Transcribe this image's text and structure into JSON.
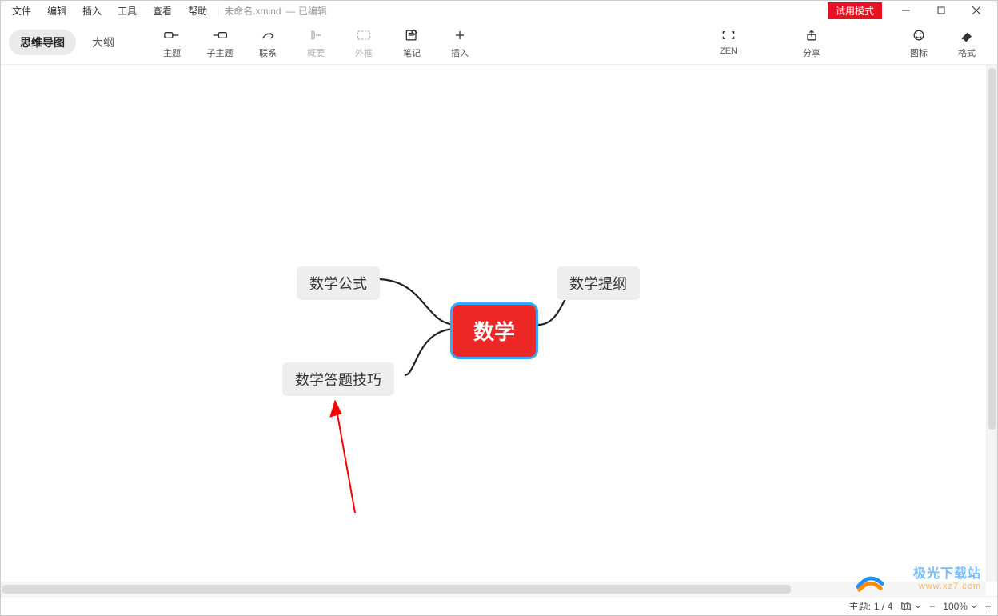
{
  "menu": {
    "file": "文件",
    "edit": "编辑",
    "insert": "插入",
    "tools": "工具",
    "view": "查看",
    "help": "帮助"
  },
  "doc": {
    "title": "未命名.xmind",
    "status": "— 已编辑"
  },
  "trial_badge": "试用模式",
  "view_tabs": {
    "mindmap": "思维导图",
    "outline": "大纲"
  },
  "toolbar": {
    "topic": "主题",
    "subtopic": "子主题",
    "relationship": "联系",
    "summary": "概要",
    "boundary": "外框",
    "notes": "笔记",
    "insert": "插入",
    "zen": "ZEN",
    "share": "分享",
    "icons": "图标",
    "format": "格式"
  },
  "mindmap": {
    "center": "数学",
    "nodes": {
      "n1": "数学公式",
      "n2": "数学答题技巧",
      "n3": "数学提纲"
    }
  },
  "status": {
    "topic_label": "主题:",
    "topic_count": "1 / 4",
    "zoom_minus": "−",
    "zoom_value": "100%",
    "zoom_plus": "+"
  },
  "watermark": {
    "brand": "极光下载站",
    "url": "www.xz7.com"
  }
}
